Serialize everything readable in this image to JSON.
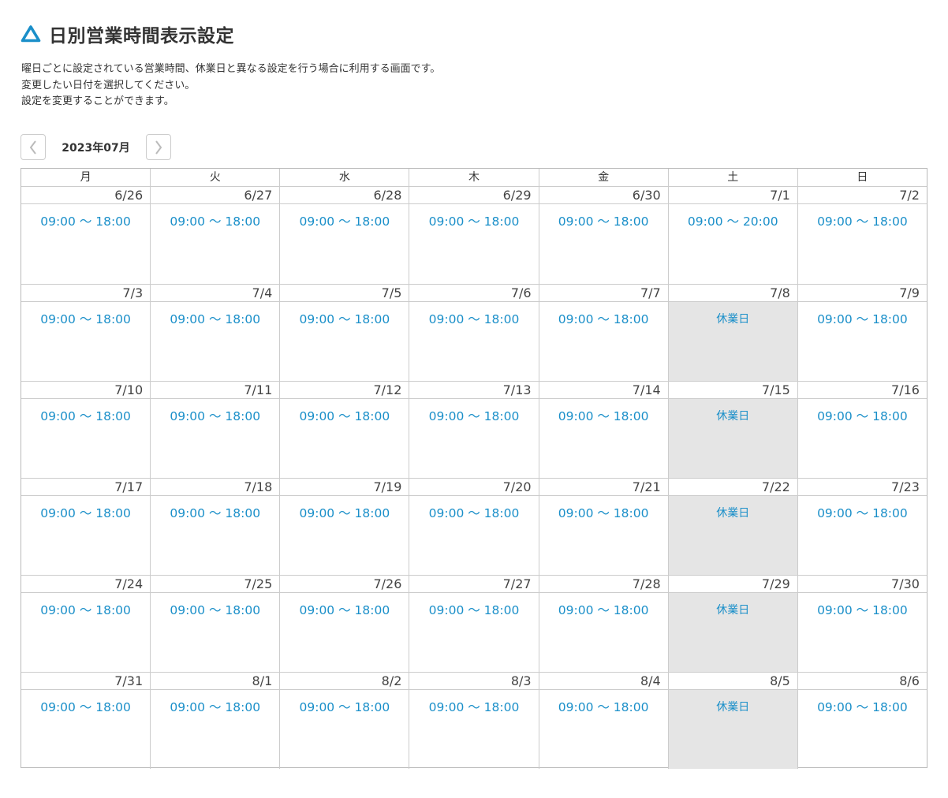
{
  "page": {
    "title": "日別営業時間表示設定",
    "description": [
      "曜日ごとに設定されている営業時間、休業日と異なる設定を行う場合に利用する画面です。",
      "変更したい日付を選択してください。",
      "設定を変更することができます。"
    ]
  },
  "nav": {
    "month": "2023年07月",
    "prev_icon": "chevron-left-icon",
    "next_icon": "chevron-right-icon"
  },
  "colors": {
    "accent": "#1a8fc9",
    "closed_bg": "#e5e5e5"
  },
  "calendar": {
    "weekdays": [
      "月",
      "火",
      "水",
      "木",
      "金",
      "土",
      "日"
    ],
    "weeks": [
      [
        {
          "date": "6/26",
          "hours": "09:00 〜 18:00",
          "closed": false
        },
        {
          "date": "6/27",
          "hours": "09:00 〜 18:00",
          "closed": false
        },
        {
          "date": "6/28",
          "hours": "09:00 〜 18:00",
          "closed": false
        },
        {
          "date": "6/29",
          "hours": "09:00 〜 18:00",
          "closed": false
        },
        {
          "date": "6/30",
          "hours": "09:00 〜 18:00",
          "closed": false
        },
        {
          "date": "7/1",
          "hours": "09:00 〜 20:00",
          "closed": false
        },
        {
          "date": "7/2",
          "hours": "09:00 〜 18:00",
          "closed": false
        }
      ],
      [
        {
          "date": "7/3",
          "hours": "09:00 〜 18:00",
          "closed": false
        },
        {
          "date": "7/4",
          "hours": "09:00 〜 18:00",
          "closed": false
        },
        {
          "date": "7/5",
          "hours": "09:00 〜 18:00",
          "closed": false
        },
        {
          "date": "7/6",
          "hours": "09:00 〜 18:00",
          "closed": false
        },
        {
          "date": "7/7",
          "hours": "09:00 〜 18:00",
          "closed": false
        },
        {
          "date": "7/8",
          "hours": "休業日",
          "closed": true
        },
        {
          "date": "7/9",
          "hours": "09:00 〜 18:00",
          "closed": false
        }
      ],
      [
        {
          "date": "7/10",
          "hours": "09:00 〜 18:00",
          "closed": false
        },
        {
          "date": "7/11",
          "hours": "09:00 〜 18:00",
          "closed": false
        },
        {
          "date": "7/12",
          "hours": "09:00 〜 18:00",
          "closed": false
        },
        {
          "date": "7/13",
          "hours": "09:00 〜 18:00",
          "closed": false
        },
        {
          "date": "7/14",
          "hours": "09:00 〜 18:00",
          "closed": false
        },
        {
          "date": "7/15",
          "hours": "休業日",
          "closed": true
        },
        {
          "date": "7/16",
          "hours": "09:00 〜 18:00",
          "closed": false
        }
      ],
      [
        {
          "date": "7/17",
          "hours": "09:00 〜 18:00",
          "closed": false
        },
        {
          "date": "7/18",
          "hours": "09:00 〜 18:00",
          "closed": false
        },
        {
          "date": "7/19",
          "hours": "09:00 〜 18:00",
          "closed": false
        },
        {
          "date": "7/20",
          "hours": "09:00 〜 18:00",
          "closed": false
        },
        {
          "date": "7/21",
          "hours": "09:00 〜 18:00",
          "closed": false
        },
        {
          "date": "7/22",
          "hours": "休業日",
          "closed": true
        },
        {
          "date": "7/23",
          "hours": "09:00 〜 18:00",
          "closed": false
        }
      ],
      [
        {
          "date": "7/24",
          "hours": "09:00 〜 18:00",
          "closed": false
        },
        {
          "date": "7/25",
          "hours": "09:00 〜 18:00",
          "closed": false
        },
        {
          "date": "7/26",
          "hours": "09:00 〜 18:00",
          "closed": false
        },
        {
          "date": "7/27",
          "hours": "09:00 〜 18:00",
          "closed": false
        },
        {
          "date": "7/28",
          "hours": "09:00 〜 18:00",
          "closed": false
        },
        {
          "date": "7/29",
          "hours": "休業日",
          "closed": true
        },
        {
          "date": "7/30",
          "hours": "09:00 〜 18:00",
          "closed": false
        }
      ],
      [
        {
          "date": "7/31",
          "hours": "09:00 〜 18:00",
          "closed": false
        },
        {
          "date": "8/1",
          "hours": "09:00 〜 18:00",
          "closed": false
        },
        {
          "date": "8/2",
          "hours": "09:00 〜 18:00",
          "closed": false
        },
        {
          "date": "8/3",
          "hours": "09:00 〜 18:00",
          "closed": false
        },
        {
          "date": "8/4",
          "hours": "09:00 〜 18:00",
          "closed": false
        },
        {
          "date": "8/5",
          "hours": "休業日",
          "closed": true
        },
        {
          "date": "8/6",
          "hours": "09:00 〜 18:00",
          "closed": false
        }
      ]
    ]
  }
}
